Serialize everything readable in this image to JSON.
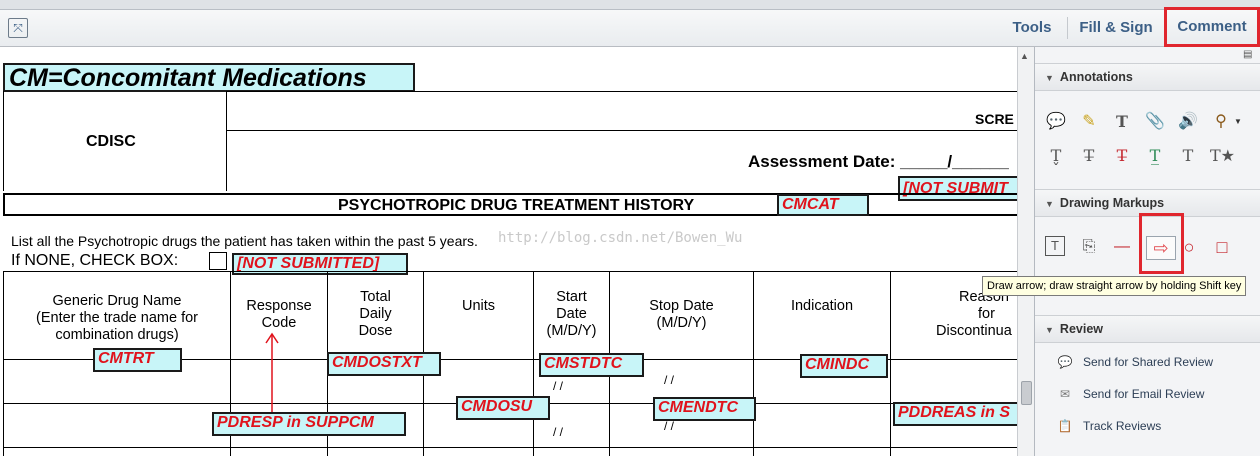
{
  "toolbar": {
    "tools_label": "Tools",
    "fill_sign_label": "Fill & Sign",
    "comment_label": "Comment"
  },
  "form": {
    "title": "CM=Concomitant Medications",
    "org": "CDISC",
    "scre_text": "SCRE",
    "assessment_text": "Assessment Date: _____/______",
    "not_submitted_1": "[NOT SUBMIT",
    "section_title": "PSYCHOTROPIC DRUG TREATMENT HISTORY",
    "cmcat": "CMCAT",
    "instructions_line1": "List  all the Psychotropic drugs the patient has taken within the past 5 years.",
    "instructions_line2": "If NONE, CHECK BOX:",
    "not_submitted_2": "[NOT SUBMITTED]",
    "watermark": "http://blog.csdn.net/Bowen_Wu",
    "columns": [
      {
        "lines": [
          "Generic Drug Name",
          "(Enter the trade name for",
          "combination drugs)"
        ]
      },
      {
        "lines": [
          "Response",
          "Code"
        ]
      },
      {
        "lines": [
          "Total",
          "Daily",
          "Dose"
        ]
      },
      {
        "lines": [
          "Units"
        ]
      },
      {
        "lines": [
          "Start",
          "Date",
          "(M/D/Y)"
        ]
      },
      {
        "lines": [
          "Stop Date",
          "(M/D/Y)"
        ]
      },
      {
        "lines": [
          "Indication"
        ]
      },
      {
        "lines": [
          "Reason",
          "for",
          "Discontinua"
        ]
      }
    ],
    "date_slashes": "/      /",
    "labels": {
      "cmtrt": "CMTRT",
      "cmdostxt": "CMDOSTXT",
      "cmstdtc": "CMSTDTC",
      "cmindc": "CMINDC",
      "pdresp": "PDRESP in SUPPCM",
      "cmdosu": "CMDOSU",
      "cmendtc": "CMENDTC",
      "pddreas": "PDDREAS in S"
    }
  },
  "pane": {
    "annotations_title": "Annotations",
    "drawing_title": "Drawing Markups",
    "review_title": "Review",
    "tooltip": "Draw arrow; draw straight arrow by holding Shift key",
    "review_items": [
      "Send for Shared Review",
      "Send for Email Review",
      "Track Reviews"
    ]
  },
  "colors": {
    "label_bg": "#c8f5f8",
    "label_text": "#e0131c",
    "highlight_border": "#e0262e",
    "toolbar_text": "#3c5f86"
  }
}
